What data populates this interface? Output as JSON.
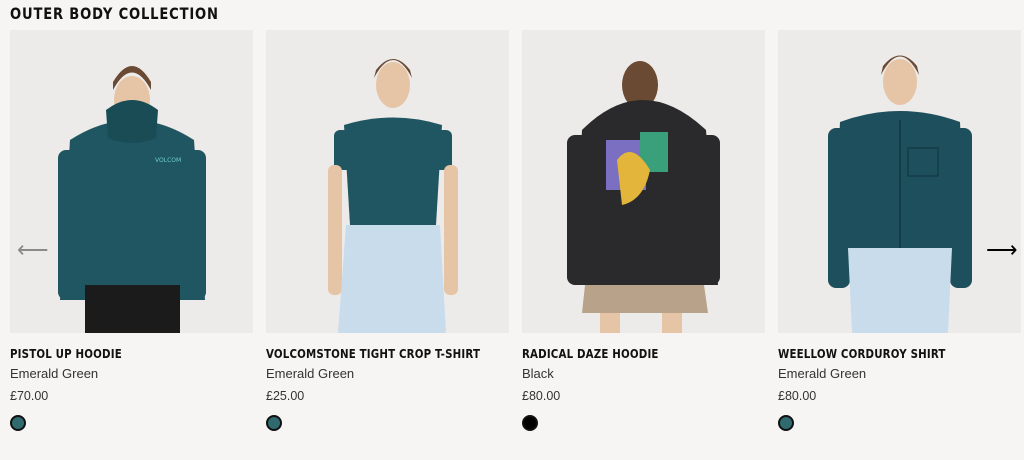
{
  "section": {
    "title": "OUTER BODY COLLECTION"
  },
  "nav": {
    "prev_glyph": "⟵",
    "next_glyph": "⟶"
  },
  "products": [
    {
      "name": "PISTOL UP HOODIE",
      "color": "Emerald Green",
      "price": "£70.00",
      "swatch": "#2e6a6e",
      "garment": "#1f5661"
    },
    {
      "name": "VOLCOMSTONE TIGHT CROP T-SHIRT",
      "color": "Emerald Green",
      "price": "£25.00",
      "swatch": "#2e6a6e",
      "garment": "#1f5661"
    },
    {
      "name": "RADICAL DAZE HOODIE",
      "color": "Black",
      "price": "£80.00",
      "swatch": "#000000",
      "garment": "#2a2a2c"
    },
    {
      "name": "WEELLOW CORDUROY SHIRT",
      "color": "Emerald Green",
      "price": "£80.00",
      "swatch": "#2e6a6e",
      "garment": "#1d4f5c"
    }
  ]
}
